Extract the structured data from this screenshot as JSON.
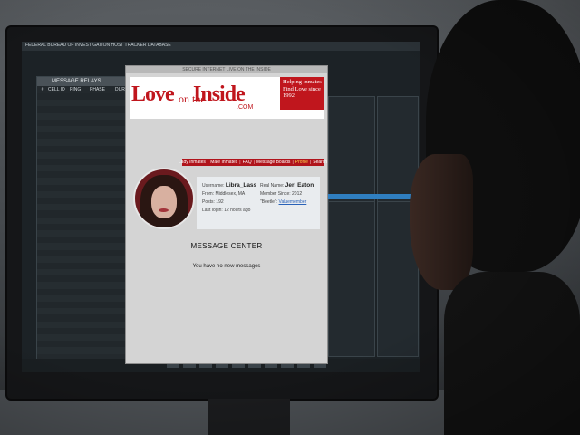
{
  "site": {
    "window_title": "SECURE INTERNET LIVE ON THE INSIDE",
    "logo_love": "Love",
    "logo_on_the": "on the",
    "logo_inside": "Inside",
    "logo_com": ".COM",
    "tagline": [
      "Helping inmates",
      "Find Love since",
      "1992"
    ],
    "nav": [
      "Lady Inmates",
      "Male Inmates",
      "FAQ",
      "Message Boards",
      "Profile",
      "Search"
    ],
    "active_nav": "Profile",
    "brand_color": "#c0161d"
  },
  "profile": {
    "username_label": "Username:",
    "username": "Libra_Lass",
    "from_label": "From:",
    "from": "Middlesex, MA",
    "posts_label": "Posts:",
    "posts": "192",
    "last_login_label": "Last login:",
    "last_login": "12 hours ago",
    "real_name_label": "Real Name:",
    "real_name": "Jeri Eaton",
    "member_since_label": "Member Since:",
    "member_since": "2012",
    "beetle_label": "\"Beetle\":",
    "beetle": "Valuemember"
  },
  "messages": {
    "title": "MESSAGE CENTER",
    "empty": "You have no new messages"
  },
  "left_panel": {
    "title": "MESSAGE RELAYS",
    "headers": [
      "#",
      "CELL ID",
      "PING",
      "PHASE",
      "DURATION"
    ]
  },
  "sysbar": {
    "left": "FEDERAL BUREAU OF INVESTIGATION HOST TRACKER DATABASE"
  }
}
